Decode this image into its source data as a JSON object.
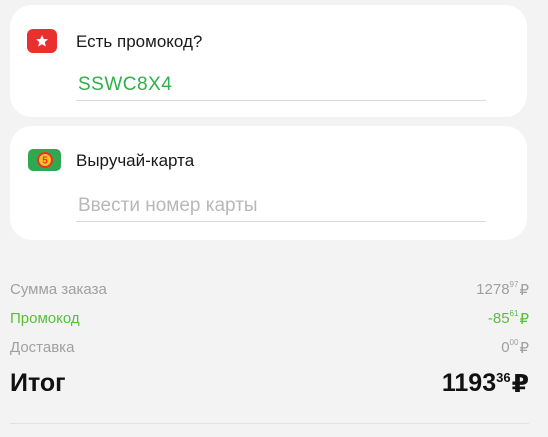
{
  "promo_card": {
    "title": "Есть промокод?",
    "value": "SSWC8X4",
    "icon": "promo-ticket-icon",
    "icon_color": "#e8312f"
  },
  "loyalty_card": {
    "title": "Выручай-карта",
    "placeholder": "Ввести номер карты",
    "icon": "loyalty-card-icon",
    "icon_color": "#2fa84f"
  },
  "summary": {
    "order_label": "Сумма заказа",
    "order_int": "1278",
    "order_frac": "97",
    "promo_label": "Промокод",
    "promo_int": "-85",
    "promo_frac": "61",
    "delivery_label": "Доставка",
    "delivery_int": "0",
    "delivery_frac": "00",
    "currency": "₽"
  },
  "total": {
    "label": "Итог",
    "int": "1193",
    "frac": "36",
    "currency": "₽"
  },
  "colors": {
    "accent_green": "#2fb04a",
    "promo_green": "#58c03a",
    "background": "#f3f3f3"
  }
}
